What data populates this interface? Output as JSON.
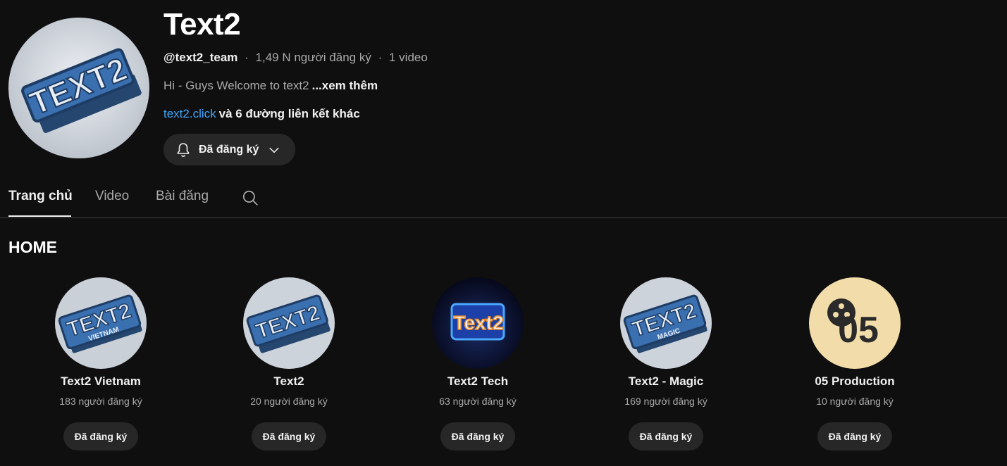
{
  "channel": {
    "title": "Text2",
    "handle": "@text2_team",
    "separator": "·",
    "subscribers": "1,49 N người đăng ký",
    "videos": "1 video",
    "description": "Hi - Guys Welcome to text2",
    "more_label": "...xem thêm",
    "link": "text2.click",
    "more_links": "và 6 đường liên kết khác",
    "subscribed_label": "Đã đăng ký",
    "avatar_icon": "text2-logo"
  },
  "tabs": [
    {
      "label": "Trang chủ",
      "active": true
    },
    {
      "label": "Video",
      "active": false
    },
    {
      "label": "Bài đăng",
      "active": false
    }
  ],
  "section": {
    "title": "HOME"
  },
  "channels": [
    {
      "name": "Text2 Vietnam",
      "subs": "183 người đăng ký",
      "button": "Đã đăng ký",
      "logo_sub": "VIETNAM"
    },
    {
      "name": "Text2",
      "subs": "20 người đăng ký",
      "button": "Đã đăng ký",
      "logo_sub": ""
    },
    {
      "name": "Text2 Tech",
      "subs": "63 người đăng ký",
      "button": "Đã đăng ký",
      "logo_sub": ""
    },
    {
      "name": "Text2 - Magic",
      "subs": "169 người đăng ký",
      "button": "Đã đăng ký",
      "logo_sub": "MAGIC"
    },
    {
      "name": "05 Production",
      "subs": "10 người đăng ký",
      "button": "Đã đăng ký",
      "logo_sub": ""
    }
  ],
  "logo_texts": {
    "text2": "TEXT2",
    "tech": "Text2",
    "production": "05"
  },
  "colors": {
    "background": "#0f0f0f",
    "link": "#3ea6ff",
    "button_bg": "#272727",
    "logo_blue": "#2f5f9e"
  }
}
